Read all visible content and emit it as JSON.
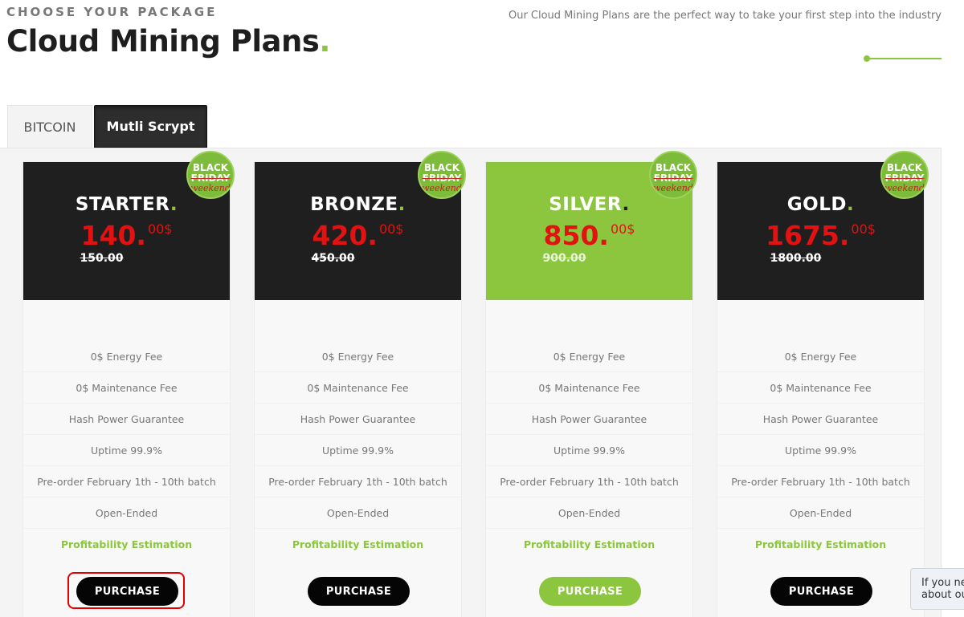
{
  "header": {
    "eyebrow": "CHOOSE YOUR PACKAGE",
    "title": "Cloud Mining Plans",
    "title_dot": ".",
    "tagline": "Our Cloud Mining Plans are the perfect way to take your first step into the industry"
  },
  "tabs": [
    {
      "label": "BITCOIN",
      "active": false
    },
    {
      "label": "Mutli Scrypt",
      "active": true
    }
  ],
  "badge": {
    "line1": "BLACK",
    "line2": "FRIDAY",
    "line3": "weekend"
  },
  "features": [
    "0$ Energy Fee",
    "0$ Maintenance Fee",
    "Hash Power Guarantee",
    "Uptime 99.9%",
    "Pre-order February 1th - 10th batch",
    "Open-Ended"
  ],
  "profitability_label": "Profitability Estimation",
  "plans": [
    {
      "name": "STARTER",
      "dot": ".",
      "price": "140.",
      "cents": "00$",
      "old_price": "150.00",
      "purchase": "PURCHASE"
    },
    {
      "name": "BRONZE",
      "dot": ".",
      "price": "420.",
      "cents": "00$",
      "old_price": "450.00",
      "purchase": "PURCHASE"
    },
    {
      "name": "SILVER",
      "dot": ".",
      "price": "850.",
      "cents": "00$",
      "old_price": "900.00",
      "purchase": "PURCHASE"
    },
    {
      "name": "GOLD",
      "dot": ".",
      "price": "1675.",
      "cents": "00$",
      "old_price": "1800.00",
      "purchase": "PURCHASE"
    }
  ],
  "chat": {
    "line1": "If you ne",
    "line2": "about ou"
  },
  "colors": {
    "accent": "#8cc63f",
    "price_red": "#e31212",
    "dark": "#1f1f1f",
    "highlight": "#e10000"
  }
}
